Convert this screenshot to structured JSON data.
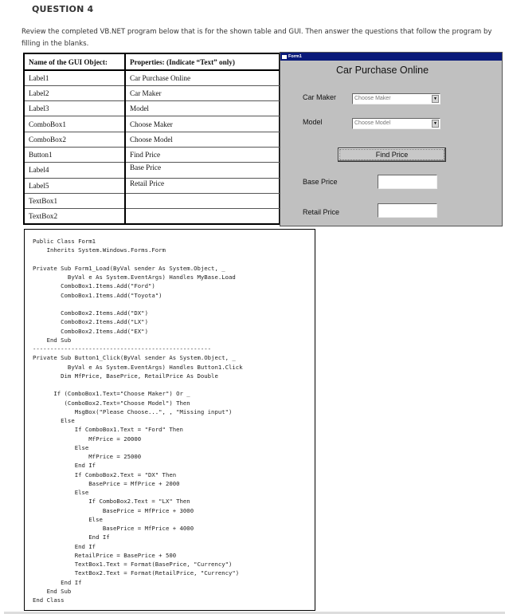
{
  "question": {
    "title": "QUESTION 4",
    "intro": "Review the completed VB.NET program below that is for the shown table and GUI.  Then answer the questions that follow the program by filling in the blanks."
  },
  "property_table": {
    "headers": [
      "Name of the GUI Object:",
      "Properties: (Indicate “Text” only)"
    ],
    "rows": [
      [
        "Label1",
        "Car Purchase Online"
      ],
      [
        "Label2",
        "Car Maker"
      ],
      [
        "Label3",
        "Model"
      ],
      [
        "ComboBox1",
        "Choose Maker"
      ],
      [
        "ComboBox2",
        "Choose Model"
      ],
      [
        "Button1",
        "Find Price"
      ],
      [
        "Label4",
        "Base Price"
      ],
      [
        "Label5",
        "Retail Price"
      ],
      [
        "TextBox1",
        ""
      ],
      [
        "TextBox2",
        ""
      ]
    ]
  },
  "form": {
    "window_title": "Form1",
    "heading": "Car Purchase Online",
    "car_maker_label": "Car Maker",
    "model_label": "Model",
    "combo_maker_value": "Choose Maker",
    "combo_model_value": "Choose Model",
    "find_button": "Find Price",
    "base_price_label": "Base Price",
    "retail_price_label": "Retail Price",
    "textbox1_value": "",
    "textbox2_value": "",
    "colors": {
      "titlebar": "#0a1a7a",
      "form_bg": "#c0c0c0"
    }
  },
  "code": {
    "lines": [
      "Public Class Form1",
      "    Inherits System.Windows.Forms.Form",
      "",
      "Private Sub Form1_Load(ByVal sender As System.Object, _",
      "          ByVal e As System.EventArgs) Handles MyBase.Load",
      "        ComboBox1.Items.Add(\"Ford\")",
      "        ComboBox1.Items.Add(\"Toyota\")",
      "",
      "        ComboBox2.Items.Add(\"DX\")",
      "        ComboBox2.Items.Add(\"LX\")",
      "        ComboBox2.Items.Add(\"EX\")",
      "    End Sub",
      "---------------------------------------------------",
      "Private Sub Button1_Click(ByVal sender As System.Object, _",
      "          ByVal e As System.EventArgs) Handles Button1.Click",
      "        Dim MfPrice, BasePrice, RetailPrice As Double",
      "",
      "      If (ComboBox1.Text=\"Choose Maker\") Or _",
      "         (ComboBox2.Text=\"Choose Model\") Then",
      "            MsgBox(\"Please Choose...\", , \"Missing input\")",
      "        Else",
      "            If ComboBox1.Text = \"Ford\" Then",
      "                MfPrice = 20000",
      "            Else",
      "                MfPrice = 25000",
      "            End If",
      "            If ComboBox2.Text = \"DX\" Then",
      "                BasePrice = MfPrice + 2000",
      "            Else",
      "                If ComboBox2.Text = \"LX\" Then",
      "                    BasePrice = MfPrice + 3000",
      "                Else",
      "                    BasePrice = MfPrice + 4000",
      "                End If",
      "            End If",
      "            RetailPrice = BasePrice + 500",
      "            TextBox1.Text = Format(BasePrice, \"Currency\")",
      "            TextBox2.Text = Format(RetailPrice, \"Currency\")",
      "        End If",
      "    End Sub",
      "End Class"
    ]
  }
}
